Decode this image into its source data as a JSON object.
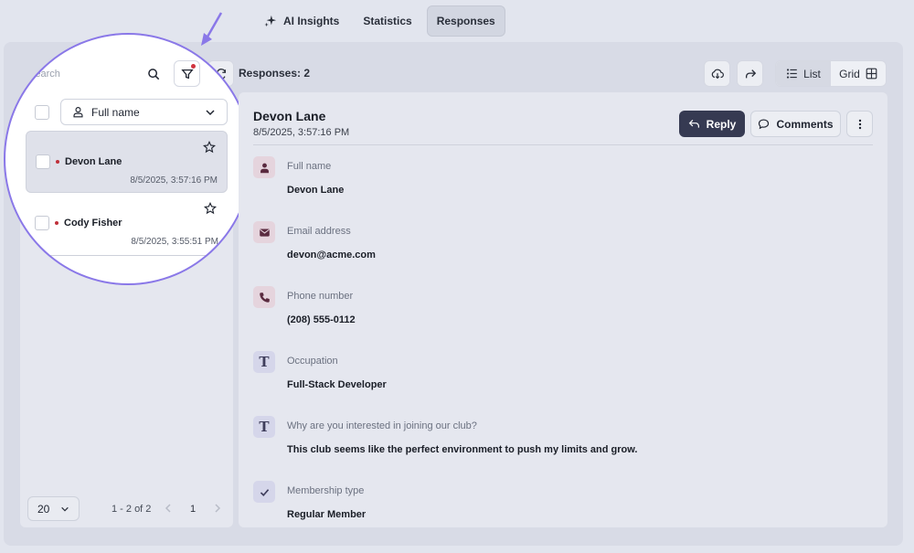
{
  "tabs": [
    {
      "label": "AI Insights",
      "icon": "sparkles-icon"
    },
    {
      "label": "Statistics"
    },
    {
      "label": "Responses",
      "active": true
    }
  ],
  "toolbar": {
    "search_placeholder": "Search",
    "responses_label": "Responses: 2",
    "view_list": "List",
    "view_grid": "Grid"
  },
  "list": {
    "field_select": "Full name",
    "items": [
      {
        "name": "Devon Lane",
        "date": "8/5/2025, 3:57:16 PM",
        "selected": true
      },
      {
        "name": "Cody Fisher",
        "date": "8/5/2025, 3:55:51 PM",
        "selected": false
      }
    ],
    "pager": {
      "page_size": "20",
      "info": "1 - 2 of 2",
      "page": "1"
    }
  },
  "detail": {
    "name": "Devon Lane",
    "date": "8/5/2025, 3:57:16 PM",
    "reply_label": "Reply",
    "comments_label": "Comments",
    "fields": [
      {
        "label": "Full name",
        "value": "Devon Lane",
        "icon": "person-icon"
      },
      {
        "label": "Email address",
        "value": "devon@acme.com",
        "icon": "mail-icon"
      },
      {
        "label": "Phone number",
        "value": "(208) 555-0112",
        "icon": "phone-icon"
      },
      {
        "label": "Occupation",
        "value": "Full-Stack Developer",
        "icon": "text-icon",
        "glyph": "T"
      },
      {
        "label": "Why are you interested in joining our club?",
        "value": "This club seems like the perfect environment to push my limits and grow.",
        "icon": "text-icon",
        "glyph": "T"
      },
      {
        "label": "Membership type",
        "value": "Regular Member",
        "icon": "check-icon"
      }
    ]
  },
  "colors": {
    "accent_circle": "#8a78e8",
    "reply_button": "#363a52",
    "unread_dot": "#c0303a"
  }
}
